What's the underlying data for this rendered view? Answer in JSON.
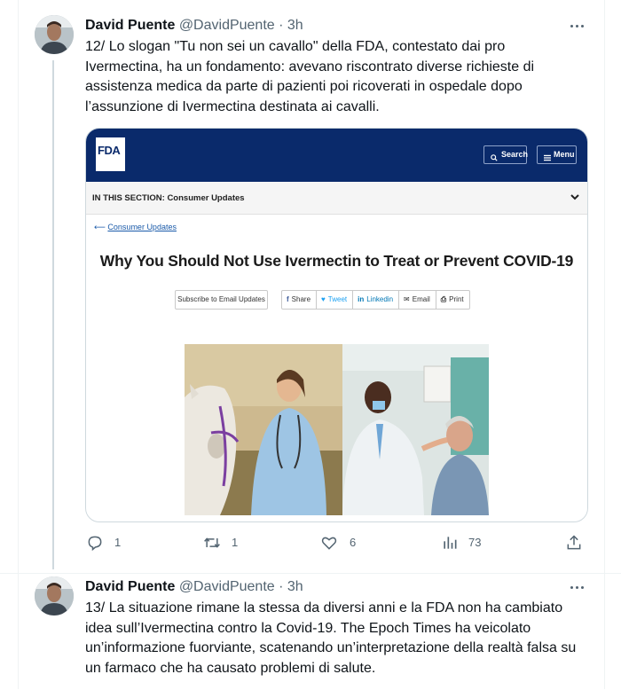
{
  "tweets": [
    {
      "author": "David Puente",
      "handle": "@DavidPuente",
      "time": "· 3h",
      "text": "12/ Lo slogan \"Tu non sei un cavallo\" della FDA, contestato dai pro Ivermectina, ha un fondamento: avevano riscontrato diverse richieste di assistenza medica da parte di pazienti poi ricoverati in ospedale dopo l’assunzione di Ivermectina destinata ai cavalli.",
      "stats": {
        "replies": "1",
        "retweets": "1",
        "likes": "6",
        "views": "73"
      }
    },
    {
      "author": "David Puente",
      "handle": "@DavidPuente",
      "time": "· 3h",
      "text": "13/ La situazione rimane la stessa da diversi anni e la FDA non ha cambiato idea sull’Ivermectina contro la Covid-19. The Epoch Times ha veicolato un’informazione fuorviante, scatenando un’interpretazione della realtà falsa su un farmaco che ha causato problemi di salute."
    }
  ],
  "card": {
    "logo": "FDA",
    "search_label": "Search",
    "menu_label": "Menu",
    "section_label": "IN THIS SECTION: Consumer Updates",
    "back_link": "Consumer Updates",
    "title": "Why You Should Not Use Ivermectin to Treat or Prevent COVID-19",
    "subscribe_label": "Subscribe to Email Updates",
    "share_buttons": [
      {
        "icon": "f",
        "label": "Share",
        "color": "#3b5998"
      },
      {
        "icon": "♥",
        "label": "Tweet",
        "color": "#1da1f2"
      },
      {
        "icon": "in",
        "label": "Linkedin",
        "color": "#0077b5"
      },
      {
        "icon": "✉",
        "label": "Email",
        "color": "#333333"
      },
      {
        "icon": "⎙",
        "label": "Print",
        "color": "#333333"
      }
    ],
    "images": [
      "veterinarian-with-horse-photo",
      "doctor-with-patient-photo"
    ]
  },
  "colors": {
    "fda_navy": "#0a2a6b",
    "muted_text": "#536471",
    "link_blue": "#1a5aa9"
  }
}
